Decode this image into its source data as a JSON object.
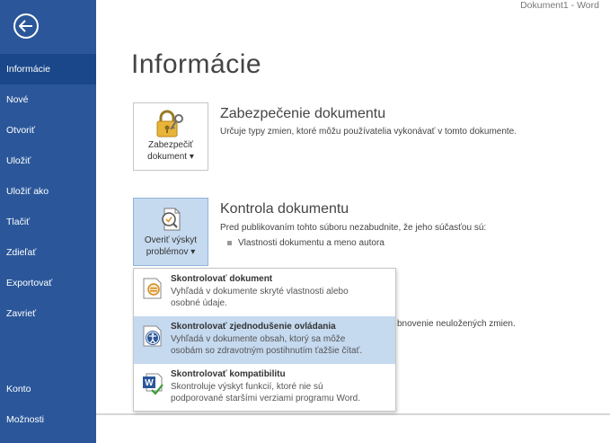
{
  "window": {
    "title": "Dokument1 - Word"
  },
  "page_title": "Informácie",
  "sidebar": {
    "items": [
      {
        "label": "Informácie",
        "active": true
      },
      {
        "label": "Nové"
      },
      {
        "label": "Otvoriť"
      },
      {
        "label": "Uložiť"
      },
      {
        "label": "Uložiť ako"
      },
      {
        "label": "Tlačiť"
      },
      {
        "label": "Zdieľať"
      },
      {
        "label": "Exportovať"
      },
      {
        "label": "Zavrieť"
      },
      {
        "label": "Konto"
      },
      {
        "label": "Možnosti"
      }
    ]
  },
  "protect": {
    "button_line1": "Zabezpečiť",
    "button_line2": "dokument ▾",
    "title": "Zabezpečenie dokumentu",
    "description": "Určuje typy zmien, ktoré môžu používatelia vykonávať v tomto dokumente."
  },
  "inspect": {
    "button_line1": "Overiť výskyt",
    "button_line2": "problémov ▾",
    "title": "Kontrola dokumentu",
    "description": "Pred publikovaním tohto súboru nezabudnite, že jeho súčasťou sú:",
    "bullet": "Vlastnosti dokumentu a meno autora"
  },
  "partial_text": "bnovenie neuložených zmien.",
  "menu": {
    "items": [
      {
        "title": "Skontrolovať dokument",
        "desc_line1": "Vyhľadá v dokumente skryté vlastnosti alebo",
        "desc_line2": "osobné údaje."
      },
      {
        "title": "Skontrolovať zjednodušenie ovládania",
        "desc_line1": "Vyhľadá v dokumente obsah, ktorý sa môže",
        "desc_line2": "osobám so zdravotným postihnutím ťažšie čítať.",
        "highlighted": true
      },
      {
        "title": "Skontrolovať kompatibilitu",
        "desc_line1": "Skontroluje výskyt funkcií, ktoré nie sú",
        "desc_line2": "podporované staršími verziami programu Word."
      }
    ]
  },
  "colors": {
    "sidebar": "#2b579a",
    "sidebar_active": "#19478a",
    "highlight": "#c5d9ef"
  }
}
